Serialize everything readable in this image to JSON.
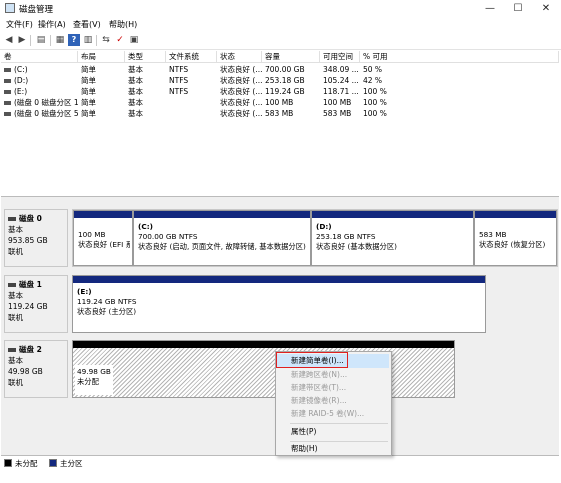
{
  "window": {
    "title": "磁盘管理",
    "controls": {
      "minimize": "—",
      "maximize": "☐",
      "close": "✕"
    }
  },
  "menu": [
    "文件(F)",
    "操作(A)",
    "查看(V)",
    "帮助(H)"
  ],
  "table": {
    "headers": [
      "卷",
      "布局",
      "类型",
      "文件系统",
      "状态",
      "容量",
      "可用空间",
      "% 可用"
    ],
    "rows": [
      [
        "(C:)",
        "简单",
        "基本",
        "NTFS",
        "状态良好 (...",
        "700.00 GB",
        "348.09 ...",
        "50 %"
      ],
      [
        "(D:)",
        "简单",
        "基本",
        "NTFS",
        "状态良好 (...",
        "253.18 GB",
        "105.24 ...",
        "42 %"
      ],
      [
        "(E:)",
        "简单",
        "基本",
        "NTFS",
        "状态良好 (...",
        "119.24 GB",
        "118.71 ...",
        "100 %"
      ],
      [
        "(磁盘 0 磁盘分区 1)",
        "简单",
        "基本",
        "",
        "状态良好 (...",
        "100 MB",
        "100 MB",
        "100 %"
      ],
      [
        "(磁盘 0 磁盘分区 5)",
        "简单",
        "基本",
        "",
        "状态良好 (...",
        "583 MB",
        "583 MB",
        "100 %"
      ]
    ]
  },
  "disks": [
    {
      "name": "磁盘 0",
      "type": "基本",
      "size": "953.85 GB",
      "status": "联机",
      "partitions": [
        {
          "name": "",
          "size": "100 MB",
          "status": "状态良好 (EFI 系"
        },
        {
          "name": "(C:)",
          "size": "700.00 GB NTFS",
          "status": "状态良好 (启动, 页面文件, 故障转储, 基本数据分区)"
        },
        {
          "name": "(D:)",
          "size": "253.18 GB NTFS",
          "status": "状态良好 (基本数据分区)"
        },
        {
          "name": "",
          "size": "583 MB",
          "status": "状态良好 (恢复分区)"
        }
      ]
    },
    {
      "name": "磁盘 1",
      "type": "基本",
      "size": "119.24 GB",
      "status": "联机",
      "partitions": [
        {
          "name": "(E:)",
          "size": "119.24 GB NTFS",
          "status": "状态良好 (主分区)"
        }
      ]
    },
    {
      "name": "磁盘 2",
      "type": "基本",
      "size": "49.98 GB",
      "status": "联机",
      "partitions": [
        {
          "name": "",
          "size": "49.98 GB",
          "status": "未分配"
        }
      ]
    }
  ],
  "legend": [
    "未分配",
    "主分区"
  ],
  "legend_colors": {
    "unallocated": "#000000",
    "primary": "#13287e"
  },
  "context_menu": {
    "items": [
      {
        "label": "新建简单卷(I)...",
        "enabled": true
      },
      {
        "label": "新建跨区卷(N)...",
        "enabled": false
      },
      {
        "label": "新建带区卷(T)...",
        "enabled": false
      },
      {
        "label": "新建镜像卷(R)...",
        "enabled": false
      },
      {
        "label": "新建 RAID-5 卷(W)...",
        "enabled": false
      },
      {
        "label": "属性(P)",
        "enabled": true
      },
      {
        "label": "帮助(H)",
        "enabled": true
      }
    ]
  },
  "toolbar_icons": [
    "back-arrow-icon",
    "forward-arrow-icon",
    "console-tree-icon",
    "properties-icon",
    "help-icon",
    "volume-list-icon",
    "connect-icon",
    "check-icon",
    "rescan-icon"
  ]
}
